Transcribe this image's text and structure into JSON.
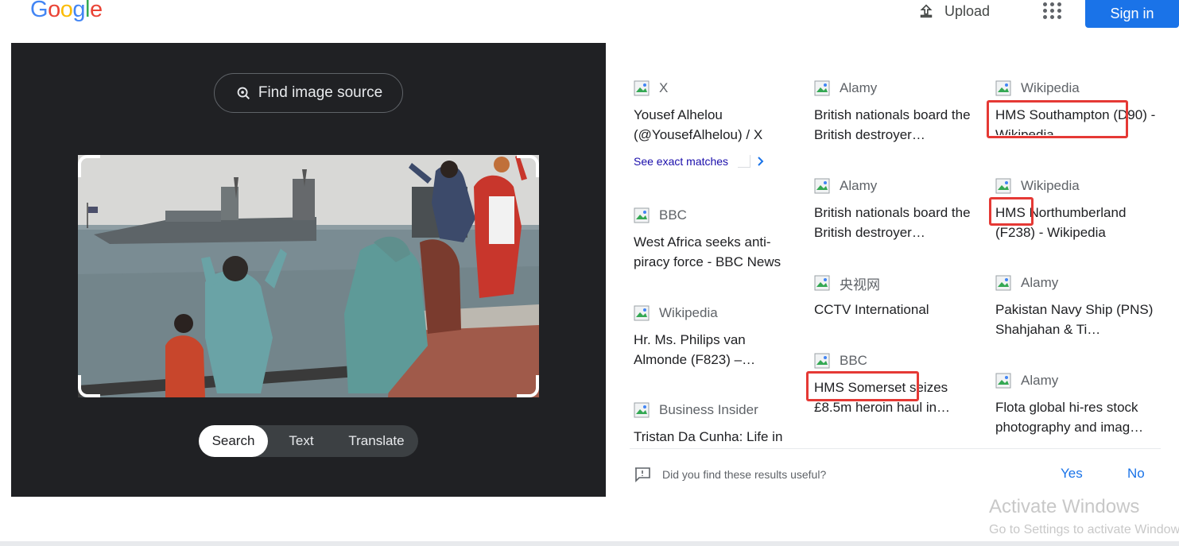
{
  "header": {
    "logo_letters": [
      "G",
      "o",
      "o",
      "g",
      "l",
      "e"
    ],
    "logo_colors": [
      "#4285f4",
      "#ea4335",
      "#fbbc05",
      "#4285f4",
      "#34a853",
      "#ea4335"
    ],
    "upload_label": "Upload",
    "signin_label": "Sign in"
  },
  "lens": {
    "find_source_label": "Find image source",
    "tabs": [
      "Search",
      "Text",
      "Translate"
    ],
    "active_tab": "Search"
  },
  "results": {
    "columns": [
      [
        {
          "source": "X",
          "title": "Yousef Alhelou (@YousefAlhelou) / X"
        },
        {
          "source": "BBC",
          "title": "West Africa seeks anti-piracy force - BBC News"
        },
        {
          "source": "Wikipedia",
          "title": "Hr. Ms. Philips van Almonde (F823) –…"
        },
        {
          "source": "Business Insider",
          "title": "Tristan Da Cunha: Life in"
        }
      ],
      [
        {
          "source": "Alamy",
          "title": "British nationals board the British destroyer…"
        },
        {
          "source": "Alamy",
          "title": "British nationals board the British destroyer…"
        },
        {
          "source": "央视网",
          "title": "CCTV International"
        },
        {
          "source": "BBC",
          "title": "HMS Somerset seizes £8.5m heroin haul in…"
        }
      ],
      [
        {
          "source": "Wikipedia",
          "title": "HMS Southampton (D90) - Wikipedia"
        },
        {
          "source": "Wikipedia",
          "title": "HMS Northumberland (F238) - Wikipedia"
        },
        {
          "source": "Alamy",
          "title": "Pakistan Navy Ship (PNS) Shahjahan & Ti…"
        },
        {
          "source": "Alamy",
          "title": "Flota global hi-res stock photography and imag…"
        }
      ]
    ],
    "exact_matches_label": "See exact matches",
    "feedback_question": "Did you find these results useful?",
    "feedback_yes": "Yes",
    "feedback_no": "No",
    "highlight_color": "#e53935"
  },
  "watermark": {
    "line1": "Activate Windows",
    "line2": "Go to Settings to activate Windows."
  }
}
